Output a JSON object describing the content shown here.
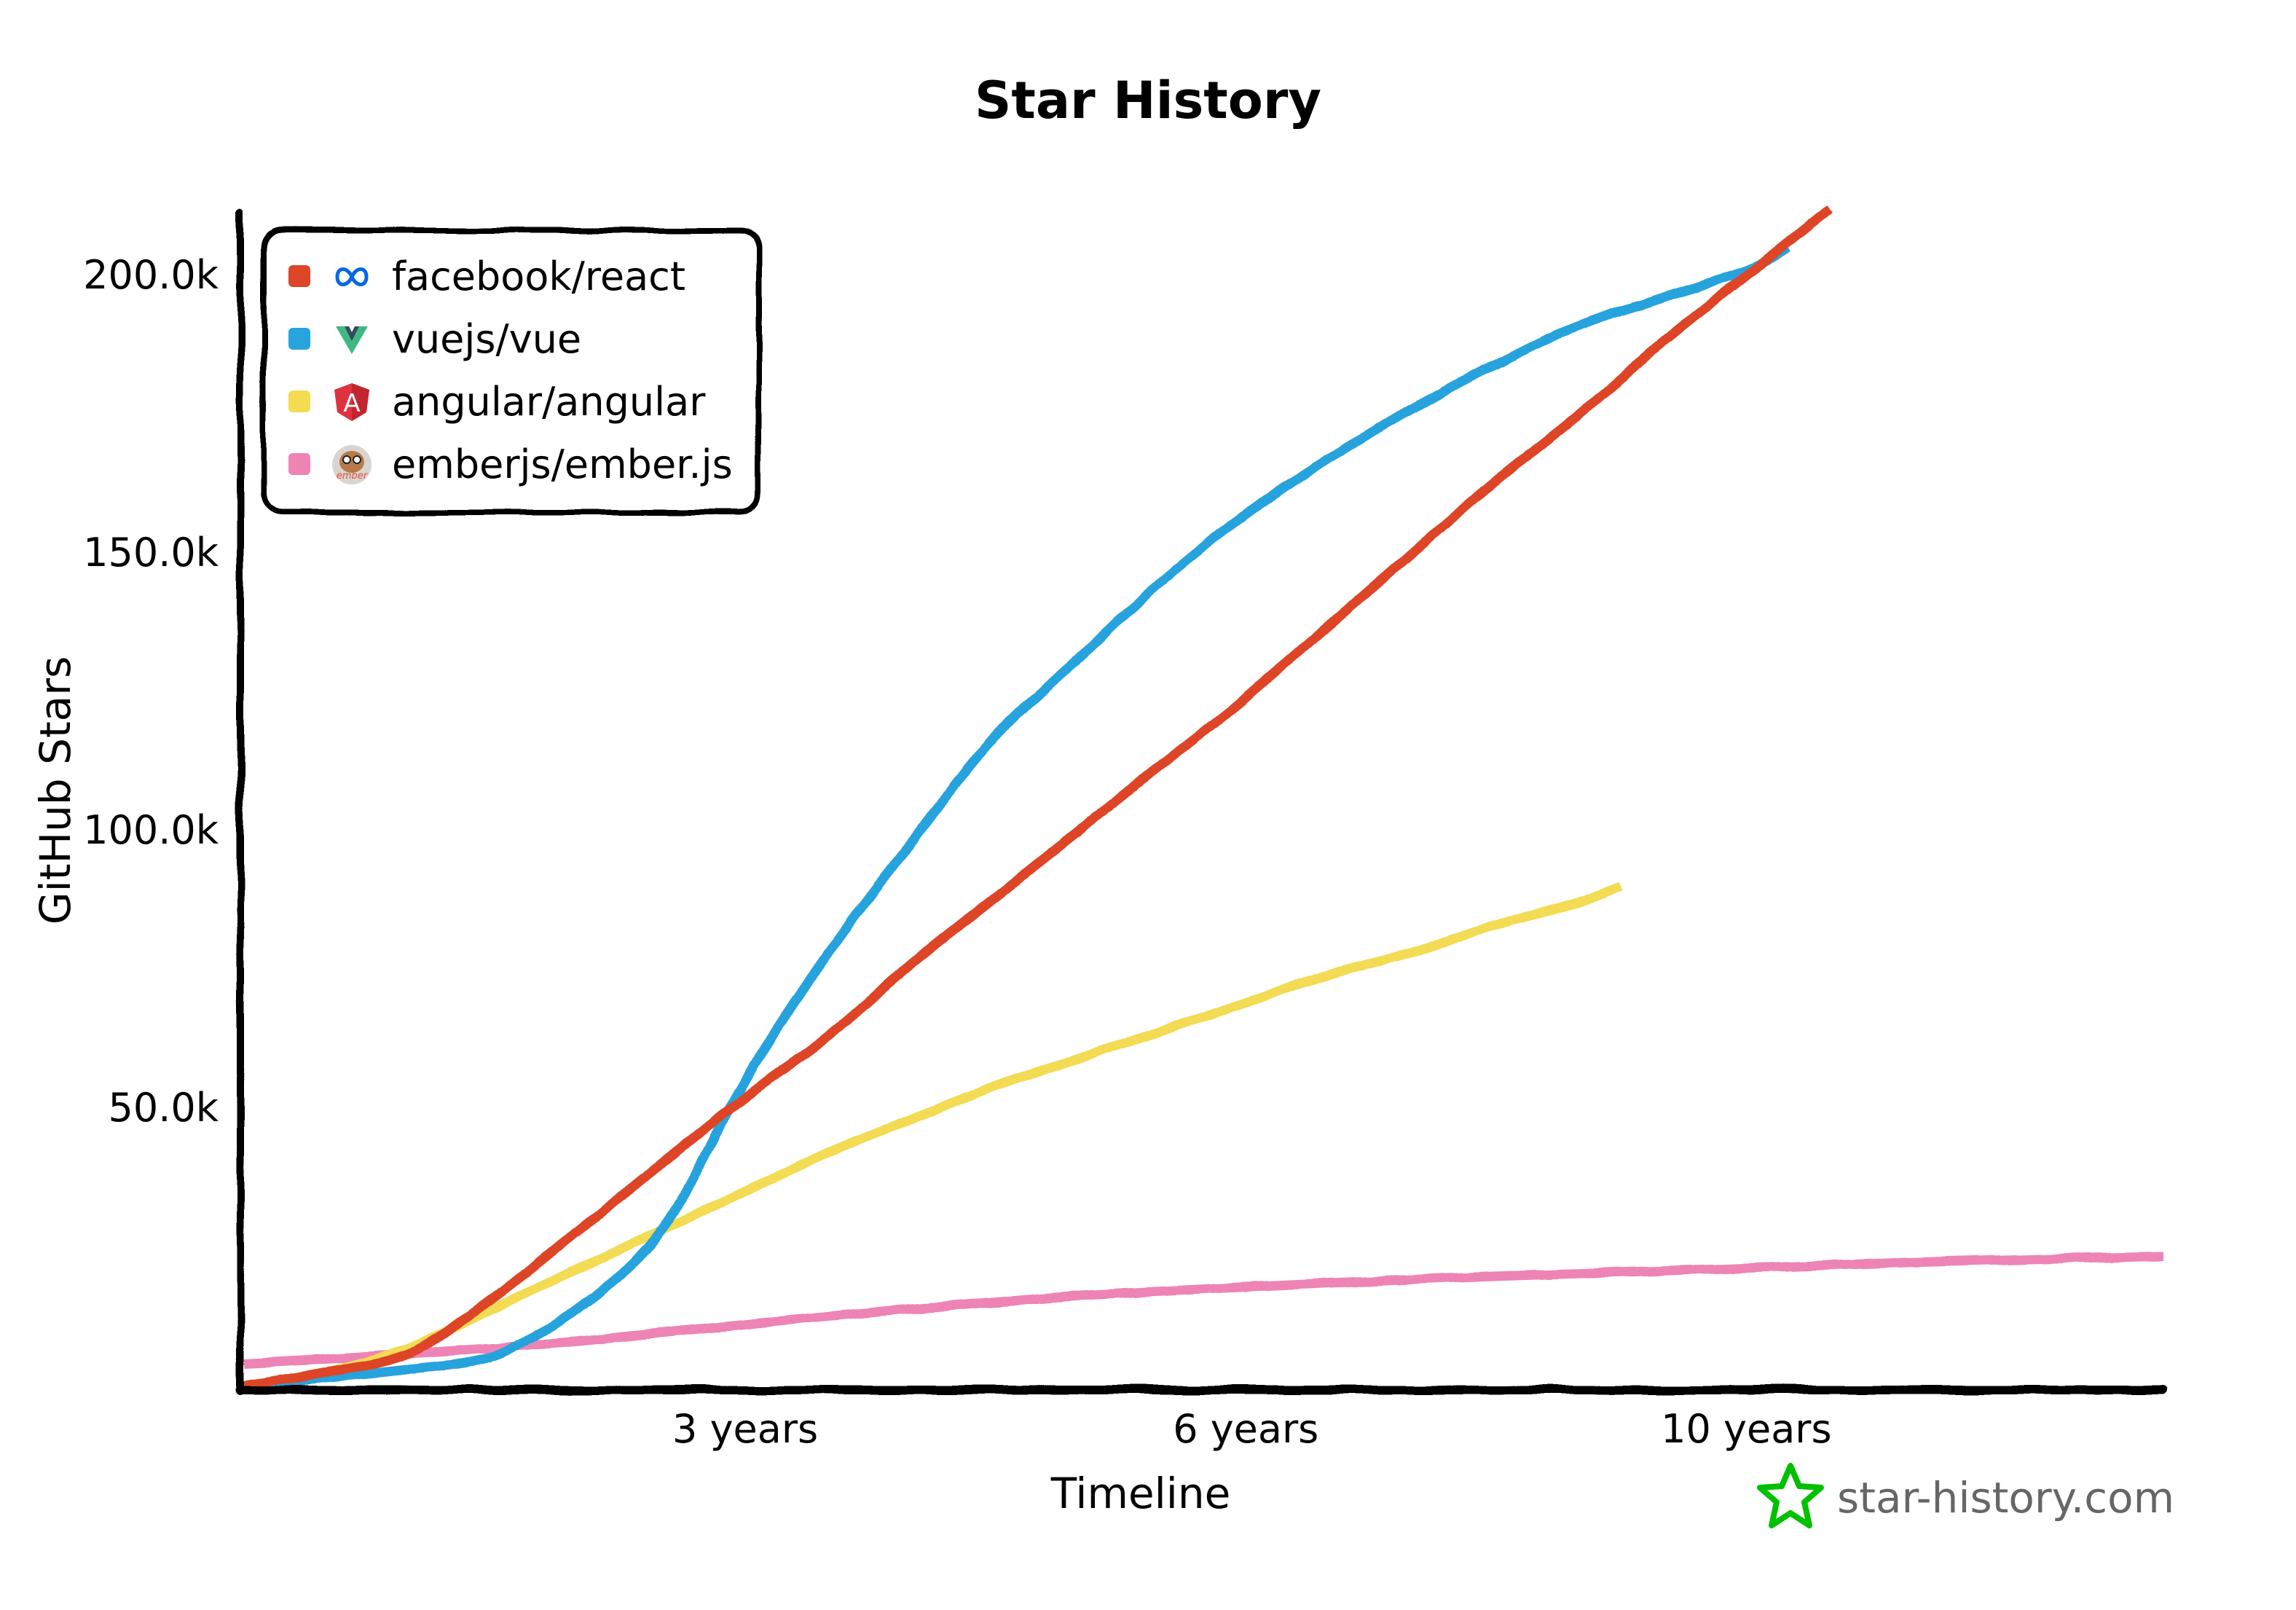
{
  "chart_data": {
    "type": "line",
    "title": "Star History",
    "xlabel": "Timeline",
    "ylabel": "GitHub Stars",
    "x_unit": "years since first star",
    "xlim": [
      0,
      11.5
    ],
    "ylim": [
      0,
      210000
    ],
    "grid": false,
    "legend_position": "top-left",
    "x_ticks": [
      {
        "value": 3,
        "label": "3 years"
      },
      {
        "value": 6,
        "label": "6 years"
      },
      {
        "value": 9,
        "label": "10 years"
      }
    ],
    "y_ticks": [
      {
        "value": 50000,
        "label": "50.0k"
      },
      {
        "value": 100000,
        "label": "100.0k"
      },
      {
        "value": 150000,
        "label": "150.0k"
      },
      {
        "value": 200000,
        "label": "200.0k"
      }
    ],
    "series": [
      {
        "name": "facebook/react",
        "icon": "meta-infinity-icon",
        "color": "#DD4528",
        "x": [
          0,
          0.5,
          1,
          1.5,
          2,
          2.5,
          3,
          3.5,
          4,
          4.5,
          5,
          5.5,
          6,
          6.5,
          7,
          7.5,
          8,
          8.5,
          9,
          9.5
        ],
        "y": [
          0,
          2500,
          6000,
          16000,
          28000,
          40000,
          52000,
          63000,
          76000,
          88000,
          100000,
          112000,
          124000,
          137000,
          150000,
          163000,
          175000,
          188000,
          200000,
          212000
        ]
      },
      {
        "name": "vuejs/vue",
        "icon": "vue-logo-icon",
        "color": "#28A3DD",
        "x": [
          0,
          0.5,
          1,
          1.5,
          2,
          2.5,
          3,
          3.5,
          4,
          4.5,
          5,
          5.5,
          6,
          6.5,
          7,
          7.5,
          8,
          8.5,
          9,
          9.25
        ],
        "y": [
          0,
          1500,
          3000,
          5500,
          14000,
          28000,
          55000,
          78000,
          98000,
          117000,
          131000,
          145000,
          157000,
          167000,
          176000,
          184000,
          191000,
          196000,
          201000,
          205000
        ]
      },
      {
        "name": "angular/angular",
        "icon": "angular-shield-icon",
        "color": "#F3DB52",
        "x": [
          0,
          0.5,
          1,
          1.5,
          2,
          2.5,
          3,
          3.5,
          4,
          4.5,
          5,
          5.5,
          6,
          6.5,
          7,
          7.5,
          8,
          8.25
        ],
        "y": [
          0,
          2500,
          7000,
          14000,
          21000,
          28000,
          35000,
          42000,
          48000,
          54000,
          59000,
          64000,
          69000,
          74000,
          78000,
          83000,
          87000,
          90000
        ]
      },
      {
        "name": "emberjs/ember.js",
        "icon": "ember-tomster-icon",
        "color": "#ED84B5",
        "x": [
          0,
          0.5,
          1,
          1.5,
          2,
          2.5,
          3,
          3.5,
          4,
          4.5,
          5,
          5.5,
          6,
          6.5,
          7,
          7.5,
          8,
          8.5,
          9,
          9.5,
          10,
          10.5,
          11,
          11.5
        ],
        "y": [
          4000,
          4800,
          5800,
          6800,
          8000,
          9500,
          11000,
          12500,
          13800,
          15000,
          16200,
          17000,
          17800,
          18500,
          19100,
          19700,
          20200,
          20700,
          21200,
          21700,
          22200,
          22600,
          23000,
          23300
        ]
      }
    ]
  },
  "watermark": {
    "text": "star-history.com",
    "icon": "star-outline-icon",
    "icon_color": "#00C000",
    "text_color": "#666666"
  }
}
